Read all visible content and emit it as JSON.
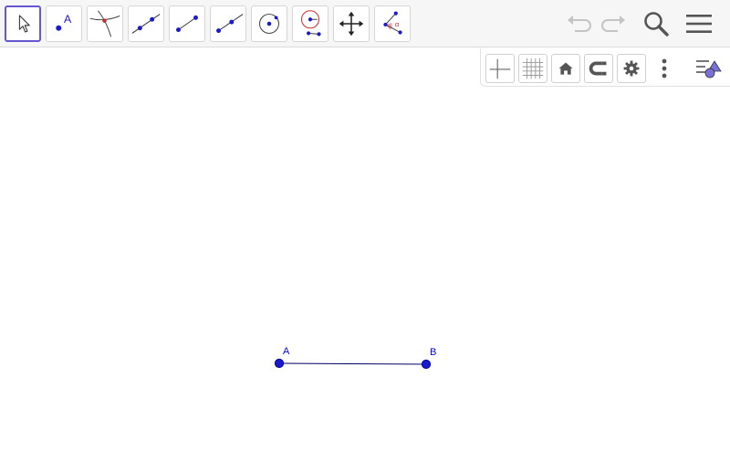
{
  "toolbar": {
    "tools": [
      {
        "name": "move-tool",
        "icon": "cursor-arrow-icon",
        "active": true
      },
      {
        "name": "point-tool",
        "icon": "point-icon",
        "label": "A"
      },
      {
        "name": "intersect-tool",
        "icon": "intersect-icon"
      },
      {
        "name": "line-tool",
        "icon": "line-icon"
      },
      {
        "name": "segment-tool",
        "icon": "segment-icon"
      },
      {
        "name": "ray-tool",
        "icon": "ray-icon"
      },
      {
        "name": "circle-tool",
        "icon": "circle-center-icon"
      },
      {
        "name": "compass-tool",
        "icon": "compass-icon"
      },
      {
        "name": "move-view-tool",
        "icon": "move-graphics-icon"
      },
      {
        "name": "angle-tool",
        "icon": "angle-icon",
        "label": "α"
      }
    ],
    "right_buttons": [
      "undo-icon",
      "redo-icon",
      "search-icon",
      "menu-icon"
    ]
  },
  "graphics_bar": {
    "buttons": [
      "axes-icon",
      "grid-icon",
      "home-icon",
      "snap-icon",
      "settings-icon",
      "more-icon",
      "algebra-view-icon"
    ]
  },
  "construction": {
    "points": [
      {
        "label": "A"
      },
      {
        "label": "B"
      }
    ],
    "segment": {
      "from": "A",
      "to": "B"
    }
  },
  "colors": {
    "accent": "#6557d2",
    "point": "#0000ff",
    "point_fill": "#1a1acc",
    "segment": "#000066"
  }
}
